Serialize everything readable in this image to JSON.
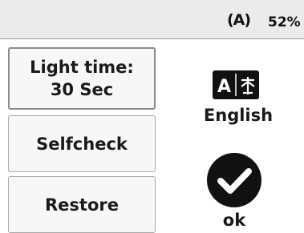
{
  "status": {
    "signal_icon": "signal-broadcast-icon",
    "signal_glyph": "(A)",
    "battery": "52%"
  },
  "menu": {
    "light_time_label": "Light time:",
    "light_time_value": "30 Sec",
    "selfcheck_label": "Selfcheck",
    "restore_label": "Restore"
  },
  "language": {
    "icon": "translate-icon",
    "label": "English"
  },
  "confirm": {
    "icon": "checkmark-circle-icon",
    "label": "ok"
  }
}
